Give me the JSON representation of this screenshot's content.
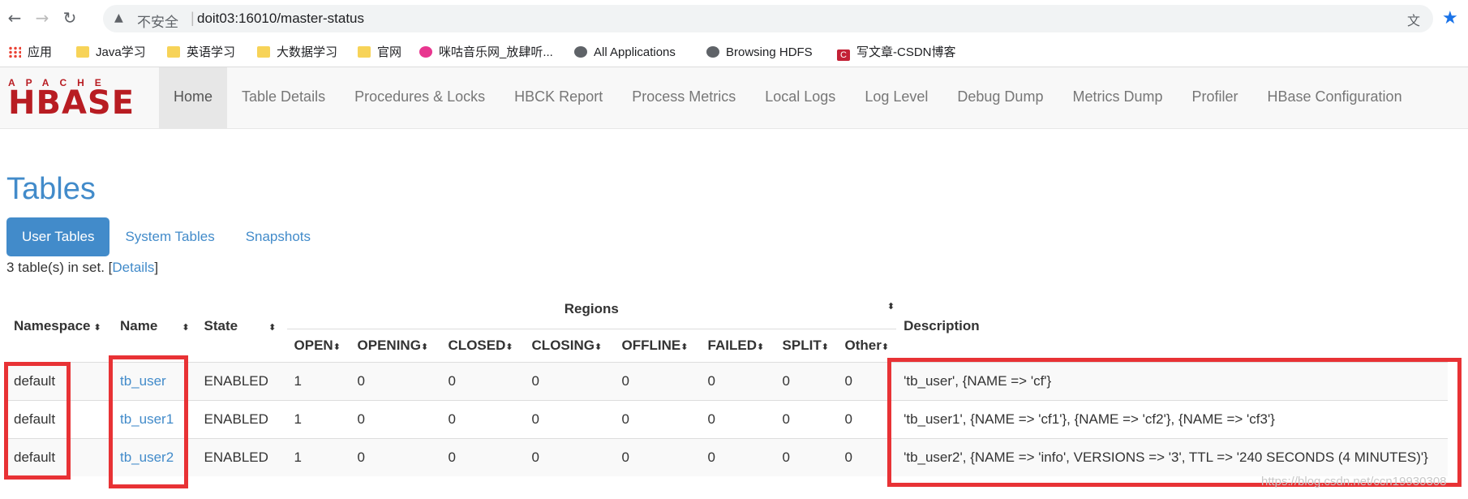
{
  "browser": {
    "security_label": "不安全",
    "url": "doit03:16010/master-status",
    "icons": [
      "back-arrow-icon",
      "forward-arrow-icon",
      "reload-icon",
      "warning-icon",
      "translate-icon",
      "star-icon"
    ],
    "bookmarks": [
      {
        "label": "应用",
        "icon": "apps-grid-icon"
      },
      {
        "label": "Java学习",
        "icon": "folder-icon"
      },
      {
        "label": "英语学习",
        "icon": "folder-icon"
      },
      {
        "label": "大数据学习",
        "icon": "folder-icon"
      },
      {
        "label": "官网",
        "icon": "folder-icon"
      },
      {
        "label": "咪咕音乐网_放肆听...",
        "icon": "migu-icon"
      },
      {
        "label": "All Applications",
        "icon": "globe-icon"
      },
      {
        "label": "Browsing HDFS",
        "icon": "globe-icon"
      },
      {
        "label": "写文章-CSDN博客",
        "icon": "csdn-icon"
      }
    ]
  },
  "logo": {
    "top": "APACHE",
    "main": "HBASE"
  },
  "nav": {
    "items": [
      "Home",
      "Table Details",
      "Procedures & Locks",
      "HBCK Report",
      "Process Metrics",
      "Local Logs",
      "Log Level",
      "Debug Dump",
      "Metrics Dump",
      "Profiler",
      "HBase Configuration"
    ]
  },
  "main": {
    "title": "Tables",
    "tabs": [
      "User Tables",
      "System Tables",
      "Snapshots"
    ],
    "count_text": "3 table(s) in set. [",
    "details_link": "Details",
    "count_close": "]"
  },
  "table": {
    "headers": {
      "namespace": "Namespace",
      "name": "Name",
      "state": "State",
      "regions": "Regions",
      "description": "Description"
    },
    "region_headers": [
      "OPEN",
      "OPENING",
      "CLOSED",
      "CLOSING",
      "OFFLINE",
      "FAILED",
      "SPLIT",
      "Other"
    ],
    "rows": [
      {
        "namespace": "default",
        "name": "tb_user",
        "state": "ENABLED",
        "regions": [
          "1",
          "0",
          "0",
          "0",
          "0",
          "0",
          "0",
          "0"
        ],
        "description": "'tb_user', {NAME => 'cf'}"
      },
      {
        "namespace": "default",
        "name": "tb_user1",
        "state": "ENABLED",
        "regions": [
          "1",
          "0",
          "0",
          "0",
          "0",
          "0",
          "0",
          "0"
        ],
        "description": "'tb_user1', {NAME => 'cf1'}, {NAME => 'cf2'}, {NAME => 'cf3'}"
      },
      {
        "namespace": "default",
        "name": "tb_user2",
        "state": "ENABLED",
        "regions": [
          "1",
          "0",
          "0",
          "0",
          "0",
          "0",
          "0",
          "0"
        ],
        "description": "'tb_user2', {NAME => 'info', VERSIONS => '3', TTL => '240 SECONDS (4 MINUTES)'}"
      }
    ]
  },
  "watermark": "https://blog.csdn.net/ccn19930308"
}
